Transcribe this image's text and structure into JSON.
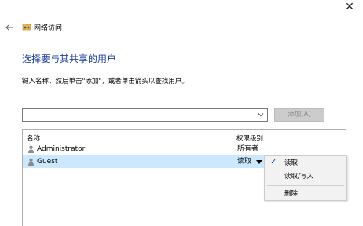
{
  "window": {
    "close_glyph": "✕"
  },
  "nav": {
    "back_icon": "arrow-left-icon",
    "title": "网络访问",
    "title_icon": "network-folder-icon"
  },
  "heading": "选择要与其共享的用户",
  "instruction": "键入名称，然后单击\"添加\"，或者单击箭头以查找用户。",
  "name_input": {
    "value": "",
    "placeholder": ""
  },
  "add_button": {
    "label": "添加(A)",
    "enabled": false
  },
  "table": {
    "columns": [
      "名称",
      "权限级别"
    ],
    "rows": [
      {
        "name": "Administrator",
        "permission": "所有者",
        "icon": "user-icon",
        "selected": false
      },
      {
        "name": "Guest",
        "permission": "读取",
        "icon": "user-icon",
        "selected": true
      }
    ]
  },
  "permission_menu": {
    "items": [
      {
        "label": "读取",
        "checked": true
      },
      {
        "label": "读取/写入",
        "checked": false
      },
      {
        "label": "删除",
        "checked": false
      }
    ]
  },
  "colors": {
    "heading": "#1e3f9b",
    "selection": "#cce8ff",
    "menu_bg": "#f2f2f2",
    "check": "#1e50b4"
  }
}
